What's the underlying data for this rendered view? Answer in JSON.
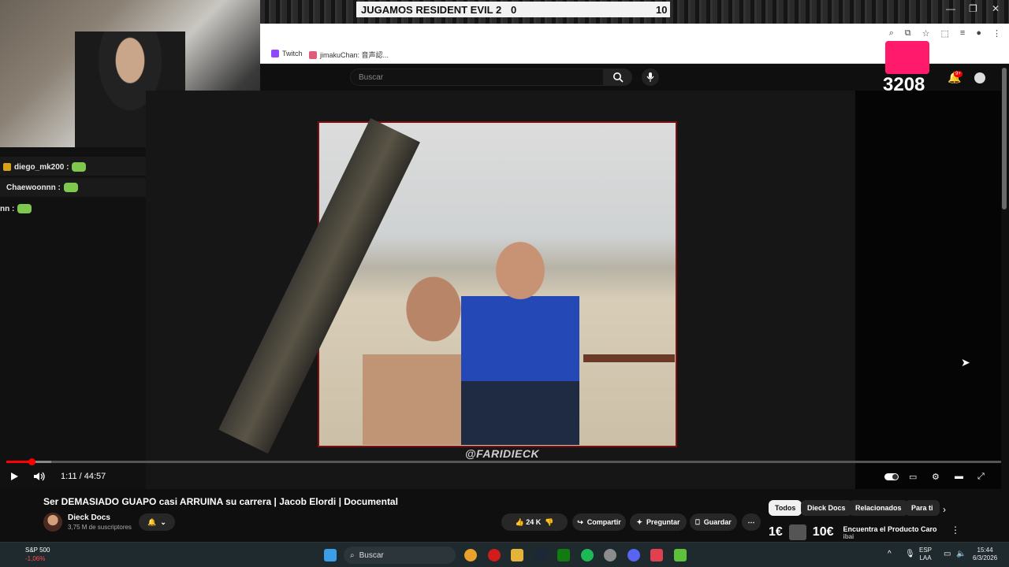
{
  "stream_overlay": {
    "scoreboard_title": "JUGAMOS RESIDENT EVIL 2",
    "score_left": "0",
    "score_right": "10",
    "viewer_counter": "3208",
    "watermark": "@FARIDIECK"
  },
  "chat": {
    "messages": [
      {
        "user": "diego_mk200 :",
        "has_badge": true
      },
      {
        "user": "Chaewoonnn :",
        "has_badge": false
      },
      {
        "user": "nn :",
        "has_badge": false
      }
    ]
  },
  "browser": {
    "bookmarks": [
      {
        "label": "Twitch",
        "icon": "twitch-icon"
      },
      {
        "label": "jimakuChan: 音声認...",
        "icon": "jimaku-icon"
      }
    ]
  },
  "youtube": {
    "search_placeholder": "Buscar",
    "notifications_badge": "9+",
    "player": {
      "time": "1:11 / 44:57",
      "progress_fraction": 0.025,
      "buffered_fraction": 0.045
    },
    "video_title": "Ser DEMASIADO GUAPO casi ARRUINA su carrera | Jacob Elordi | Documental",
    "channel_name": "Dieck Docs",
    "subscribers": "3,75 M de suscriptores",
    "likes": "24 K",
    "share_label": "Compartir",
    "ask_label": "Preguntar",
    "save_label": "Guardar",
    "chips": [
      "Todos",
      "Dieck Docs",
      "Relacionados",
      "Para ti"
    ],
    "ad": {
      "price_left": "1€",
      "price_right": "10€",
      "title": "Encuentra el Producto Caro",
      "channel": "ibai"
    }
  },
  "taskbar": {
    "search_placeholder": "Buscar",
    "stock_name": "S&P 500",
    "stock_change": "-1,06%",
    "lang_top": "ESP",
    "lang_bottom": "LAA",
    "time": "15:44",
    "date": "6/3/2026"
  },
  "colors": {
    "youtube_red": "#ff0000",
    "chat_emote": "#7ec850",
    "stock_down": "#ff4d4d"
  }
}
